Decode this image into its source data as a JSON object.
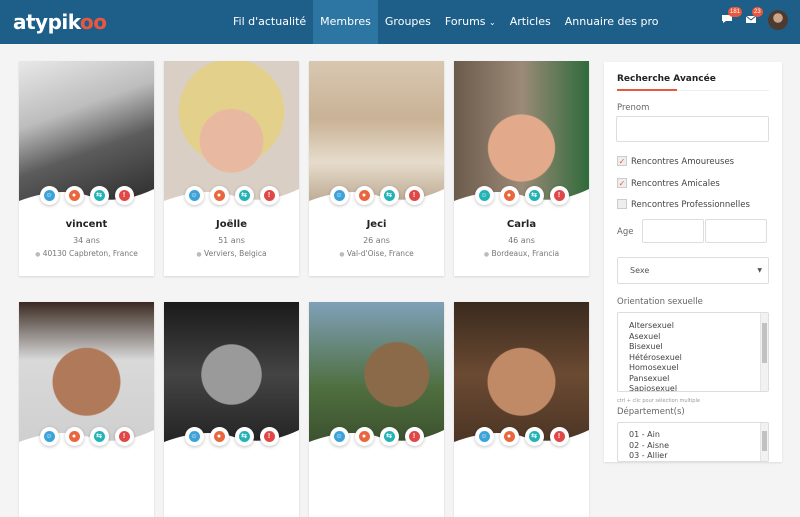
{
  "header": {
    "logo_text": "atypik",
    "logo_accent": "oo",
    "nav": [
      {
        "label": "Fil d'actualité",
        "active": false
      },
      {
        "label": "Membres",
        "active": true
      },
      {
        "label": "Groupes",
        "active": false
      },
      {
        "label": "Forums",
        "active": false,
        "caret": "⌄"
      },
      {
        "label": "Articles",
        "active": false
      },
      {
        "label": "Annuaire des pro",
        "active": false
      }
    ],
    "messages_badge": "181",
    "notifications_badge": "23",
    "icons": [
      "chat-icon",
      "mail-icon",
      "user-avatar"
    ]
  },
  "members": [
    {
      "name": "vincent",
      "age": "34 ans",
      "location": "40130 Capbreton, France"
    },
    {
      "name": "Joëlle",
      "age": "51 ans",
      "location": "Verviers, Belgica"
    },
    {
      "name": "Jeci",
      "age": "26 ans",
      "location": "Val-d'Oise, France"
    },
    {
      "name": "Carla",
      "age": "46 ans",
      "location": "Bordeaux, Francia"
    },
    {
      "name": "",
      "age": "",
      "location": ""
    },
    {
      "name": "",
      "age": "",
      "location": ""
    },
    {
      "name": "",
      "age": "",
      "location": ""
    },
    {
      "name": "",
      "age": "",
      "location": ""
    }
  ],
  "card_actions": [
    "smile-icon",
    "chat-icon",
    "swap-icon",
    "alert-icon"
  ],
  "sidebar": {
    "title": "Recherche Avancée",
    "prenom_label": "Prenom",
    "prenom_value": "",
    "checkboxes": [
      {
        "label": "Rencontres Amoureuses",
        "checked": true
      },
      {
        "label": "Rencontres Amicales",
        "checked": true
      },
      {
        "label": "Rencontres Professionnelles",
        "checked": false
      }
    ],
    "age_label": "Age",
    "sexe_label": "Sexe",
    "orientation_label": "Orientation sexuelle",
    "orientations": [
      "Altersexuel",
      "Asexuel",
      "Bisexuel",
      "Hétérosexuel",
      "Homosexuel",
      "Pansexuel",
      "Sapiosexuel"
    ],
    "multi_hint": "ctrl + clic pour sélection multiple",
    "departement_label": "Département(s)",
    "departements": [
      "01 - Ain",
      "02 - Aisne",
      "03 - Allier"
    ]
  },
  "colors": {
    "header": "#1e5f8a",
    "accent": "#e8573f"
  }
}
